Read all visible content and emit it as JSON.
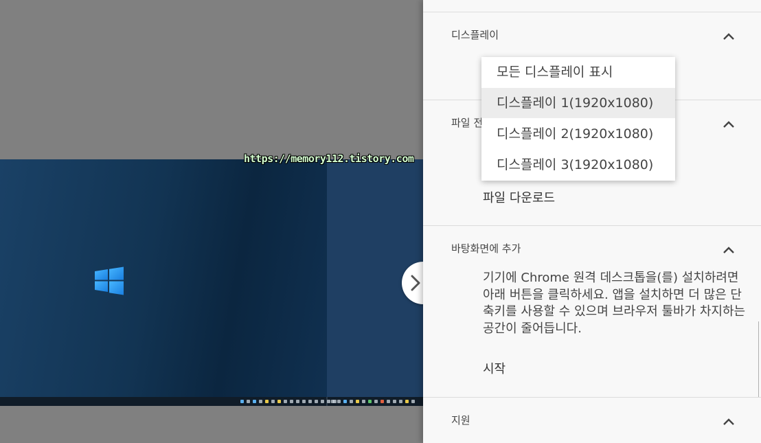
{
  "watermark": "https://memory112.tistory.com",
  "panel": {
    "display_section": {
      "title": "디스플레이"
    },
    "file_section": {
      "title_partial": "파일 전",
      "download_label": "파일 다운로드"
    },
    "desktop_section": {
      "title": "바탕화면에 추가",
      "description": "기기에 Chrome 원격 데스크톱을(를) 설치하려면 아래 버튼을 클릭하세요. 앱을 설치하면 더 많은 단축키를 사용할 수 있으며 브라우저 툴바가 차지하는 공간이 줄어듭니다.",
      "start_label": "시작"
    },
    "support_section": {
      "title": "지원"
    }
  },
  "display_menu": {
    "options": [
      "모든 디스플레이 표시",
      "디스플레이 1(1920x1080)",
      "디스플레이 2(1920x1080)",
      "디스플레이 3(1920x1080)"
    ],
    "hovered_index": 1
  },
  "icons": {
    "toggle": "chevron-right-icon",
    "collapse": "chevron-up-icon",
    "desktop_logo": "windows-logo-icon"
  },
  "colors": {
    "panel_bg": "#f8f8f8",
    "desktop_bg": "#123453",
    "logo": "#1e90ff",
    "watermark": "#d4ffd0"
  }
}
